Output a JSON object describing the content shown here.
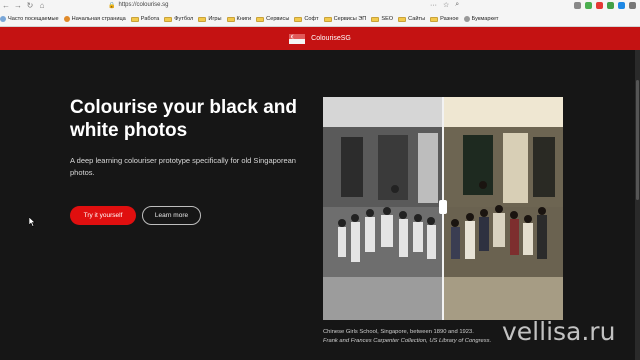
{
  "browser": {
    "url": "https://colourise.sg",
    "bookmarks": [
      "Часто посещаемые",
      "Начальная страница",
      "Работа",
      "Футбол",
      "Игры",
      "Книги",
      "Сервисы",
      "Софт",
      "Сервисы ЭП",
      "SEO",
      "Сайты",
      "Разное",
      "Букмаркет"
    ]
  },
  "header": {
    "brand": "ColouriseSG"
  },
  "hero": {
    "title": "Colourise your black and white photos",
    "subtitle": "A deep learning colouriser prototype specifically for old Singaporean photos.",
    "primary_button": "Try it yourself",
    "secondary_button": "Learn more"
  },
  "photo": {
    "caption_line1": "Chinese Girls School, Singapore, between 1890 and 1923.",
    "caption_line2": "Frank and Frances Carpenter Collection, US Library of Congress."
  },
  "watermark": "vellisa.ru",
  "colors": {
    "red": "#c41212",
    "button": "#e00f0f",
    "background": "#161616"
  }
}
